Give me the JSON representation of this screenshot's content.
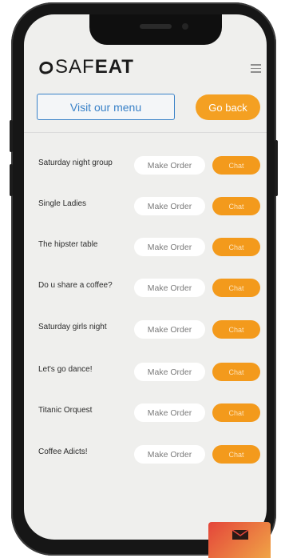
{
  "header": {
    "logo_prefix": "SAF",
    "logo_suffix": "EAT",
    "menu_icon": "hamburger-menu-icon"
  },
  "actions": {
    "visit_menu_label": "Visit our menu",
    "go_back_label": "Go back"
  },
  "groups": [
    {
      "name": "Saturday night group",
      "order_label": "Make Order",
      "chat_label": "Chat"
    },
    {
      "name": "Single Ladies",
      "order_label": "Make Order",
      "chat_label": "Chat"
    },
    {
      "name": "The hipster table",
      "order_label": "Make Order",
      "chat_label": "Chat"
    },
    {
      "name": "Do u share a coffee?",
      "order_label": "Make Order",
      "chat_label": "Chat"
    },
    {
      "name": "Saturday girls night",
      "order_label": "Make Order",
      "chat_label": "Chat"
    },
    {
      "name": "Let's go dance!",
      "order_label": "Make Order",
      "chat_label": "Chat"
    },
    {
      "name": "Titanic Orquest",
      "order_label": "Make Order",
      "chat_label": "Chat"
    },
    {
      "name": "Coffee Adicts!",
      "order_label": "Make Order",
      "chat_label": "Chat"
    }
  ],
  "fab": {
    "icon": "mail-icon"
  },
  "colors": {
    "accent": "#f39a1c",
    "link": "#3a82c8",
    "background": "#efefed"
  }
}
